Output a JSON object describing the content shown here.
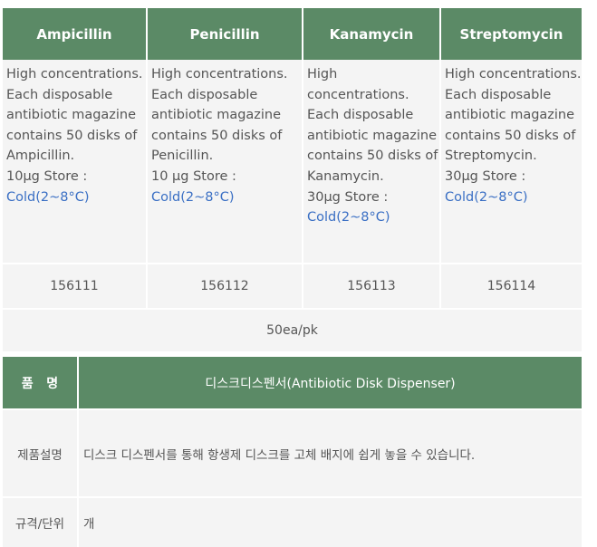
{
  "antibiotics": [
    {
      "name": "Ampicillin",
      "lines": [
        "High concentrations.",
        "Each disposable",
        "antibiotic magazine",
        "contains 50 disks of",
        "Ampicillin.",
        "10μg Store :"
      ],
      "storage": "Cold(2~8°C)",
      "code": "156111"
    },
    {
      "name": "Penicillin",
      "lines": [
        "High concentrations.",
        "Each disposable",
        "antibiotic magazine",
        "contains 50 disks of",
        "Penicillin.",
        "10 μg Store :"
      ],
      "storage": "Cold(2~8°C)",
      "code": "156112"
    },
    {
      "name": "Kanamycin",
      "lines": [
        "High concentrations.",
        "Each disposable",
        "antibiotic magazine",
        "contains 50 disks of",
        "Kanamycin.",
        "30μg Store :"
      ],
      "storage": "Cold(2~8°C)",
      "code": "156113"
    },
    {
      "name": "Streptomycin",
      "lines": [
        "High concentrations.",
        "Each disposable",
        "antibiotic magazine",
        "contains 50 disks of",
        "Streptomycin.",
        "30μg Store :"
      ],
      "storage": "Cold(2~8°C)",
      "code": "156114"
    }
  ],
  "pack": "50ea/pk",
  "product": {
    "name_label": "품   명",
    "name_value": "디스크디스펜서(Antibiotic Disk Dispenser)",
    "desc_label": "제품설명",
    "desc_value": "디스크 디스펜서를 통해 항생제 디스크를 고체 배지에 쉽게 놓을 수 있습니다.",
    "unit_label": "규격/단위",
    "unit_value": "개"
  },
  "colors": {
    "header_green": "#5b8a66",
    "cell_gray": "#f4f4f4",
    "storage_blue": "#3a6fc4"
  }
}
